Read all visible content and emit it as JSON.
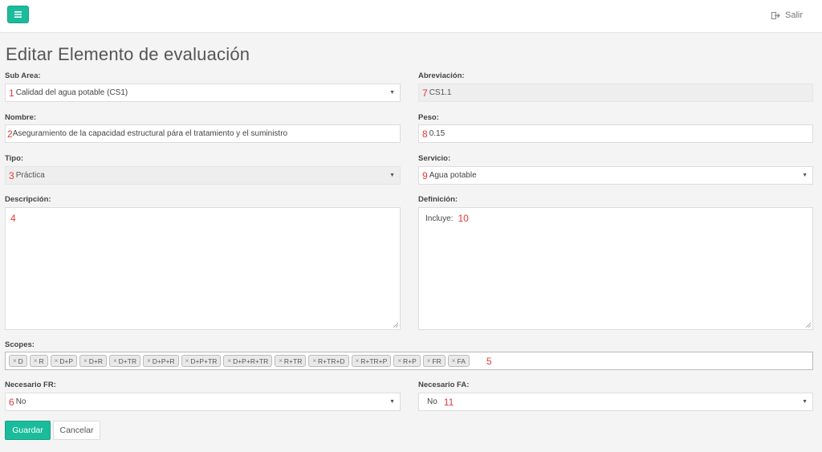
{
  "topbar": {
    "menu_icon": "hamburger-icon",
    "logout_label": "Salir",
    "logout_icon": "sign-out-icon"
  },
  "page": {
    "title": "Editar Elemento de evaluación"
  },
  "colors": {
    "accent": "#1abc9c",
    "annotation": "#e53935"
  },
  "form": {
    "sub_area": {
      "label": "Sub Area:",
      "marker": "1",
      "value": "Calidad del agua potable (CS1)"
    },
    "abreviacion": {
      "label": "Abreviación:",
      "marker": "7",
      "value": "CS1.1"
    },
    "nombre": {
      "label": "Nombre:",
      "marker": "2",
      "value": "Aseguramiento de la capacidad estructural pára el tratamiento y el suministro"
    },
    "peso": {
      "label": "Peso:",
      "marker": "8",
      "value": "0.15"
    },
    "tipo": {
      "label": "Tipo:",
      "marker": "3",
      "value": "Práctica"
    },
    "servicio": {
      "label": "Servicio:",
      "marker": "9",
      "value": "Agua potable"
    },
    "descripcion": {
      "label": "Descripción:",
      "marker": "4",
      "value": ""
    },
    "definicion": {
      "label": "Definición:",
      "marker": "10",
      "value": "Incluye:"
    },
    "scopes": {
      "label": "Scopes:",
      "marker": "5",
      "tags": [
        "D",
        "R",
        "D+P",
        "D+R",
        "D+TR",
        "D+P+R",
        "D+P+TR",
        "D+P+R+TR",
        "R+TR",
        "R+TR+D",
        "R+TR+P",
        "R+P",
        "FR",
        "FA"
      ]
    },
    "necesario_fr": {
      "label": "Necesario FR:",
      "marker": "6",
      "value": "No"
    },
    "necesario_fa": {
      "label": "Necesario FA:",
      "marker": "11",
      "value": "No"
    }
  },
  "actions": {
    "save_label": "Guardar",
    "cancel_label": "Cancelar"
  }
}
